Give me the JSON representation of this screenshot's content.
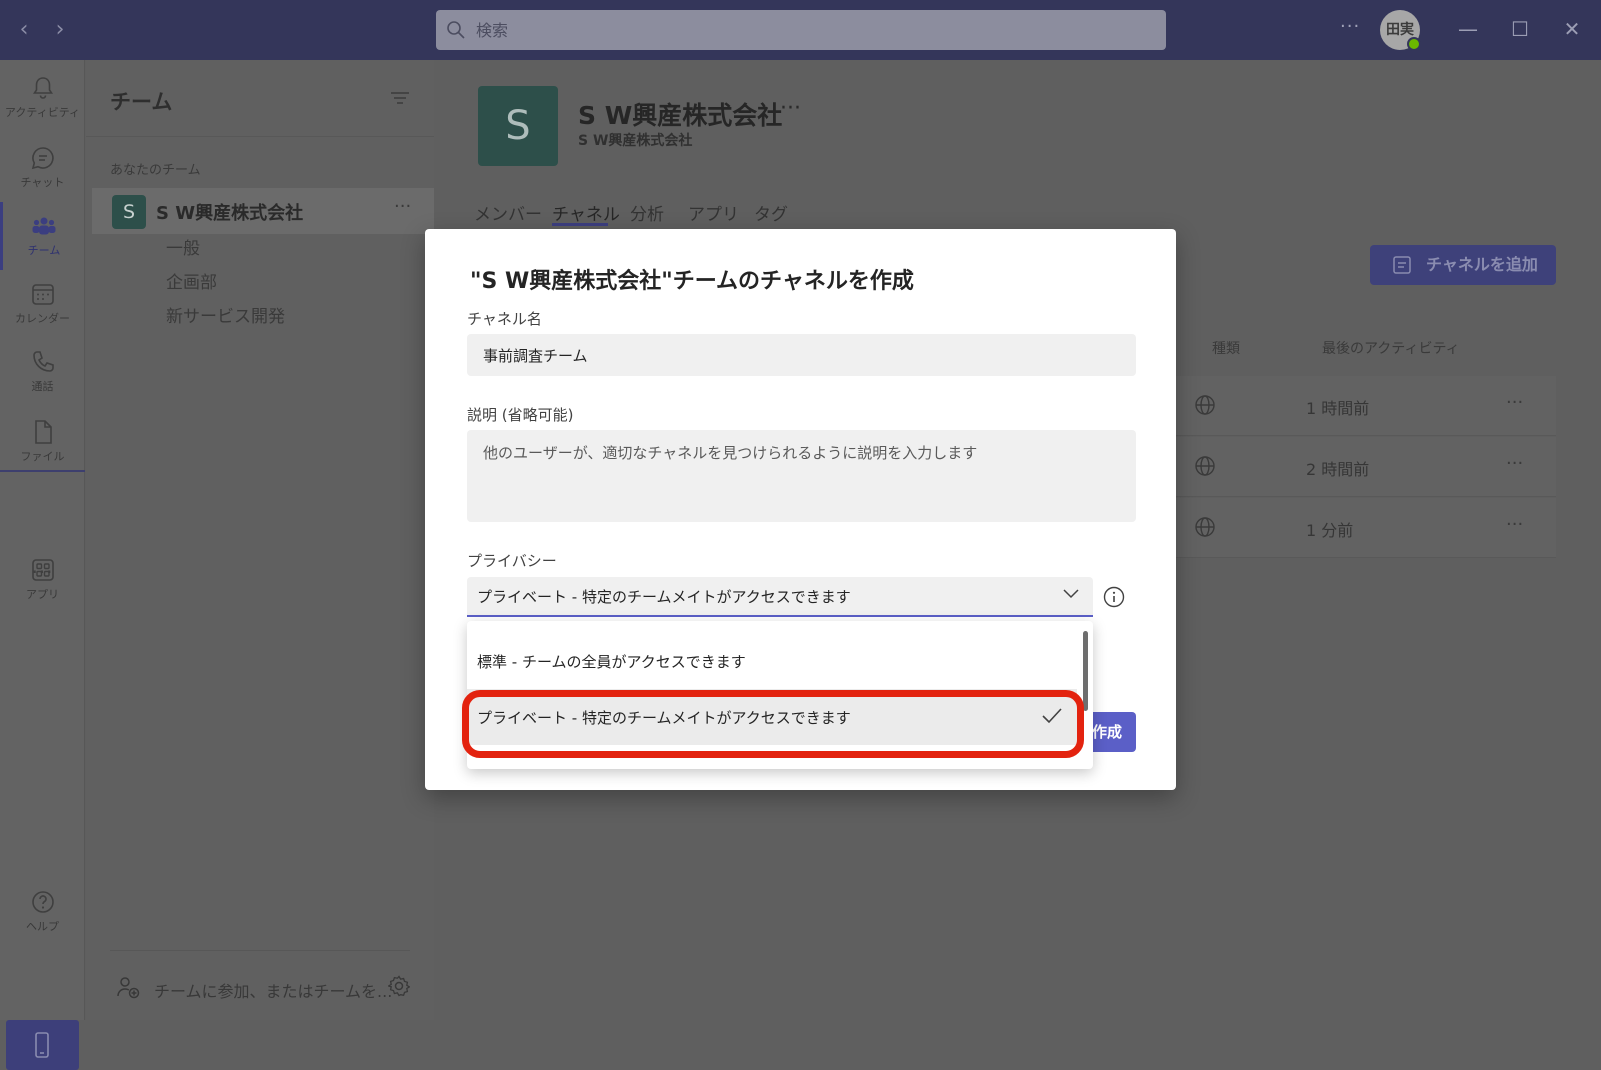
{
  "titlebar": {
    "search_placeholder": "検索",
    "more": "···",
    "avatar_initials": "田実"
  },
  "rail": {
    "items": [
      {
        "label": "アクティビティ",
        "icon": "bell-icon"
      },
      {
        "label": "チャット",
        "icon": "chat-icon"
      },
      {
        "label": "チーム",
        "icon": "teams-icon"
      },
      {
        "label": "カレンダー",
        "icon": "calendar-icon"
      },
      {
        "label": "通話",
        "icon": "phone-icon"
      },
      {
        "label": "ファイル",
        "icon": "file-icon"
      },
      {
        "label": "アプリ",
        "icon": "apps-icon"
      },
      {
        "label": "ヘルプ",
        "icon": "help-icon"
      }
    ],
    "more": "···"
  },
  "panel": {
    "title": "チーム",
    "section_label": "あなたのチーム",
    "team": {
      "badge": "S",
      "name": "S W興産株式会社",
      "more": "···"
    },
    "channels": [
      "一般",
      "企画部",
      "新サービス開発"
    ],
    "join_text": "チームに参加、またはチームを..."
  },
  "main": {
    "logo_letter": "S",
    "title": "S W興産株式会社",
    "title_more": "···",
    "subtitle": "S W興産株式会社",
    "tabs": [
      "メンバー",
      "チャネル",
      "分析",
      "アプリ",
      "タグ"
    ],
    "add_channel_label": "チャネルを追加",
    "columns": {
      "type": "種類",
      "last_activity": "最後のアクティビティ"
    },
    "rows": [
      {
        "time": "1 時間前",
        "more": "···"
      },
      {
        "time": "2 時間前",
        "more": "···"
      },
      {
        "time": "1 分前",
        "more": "···"
      }
    ]
  },
  "modal": {
    "title": "\"S W興産株式会社\"チームのチャネルを作成",
    "channel_name_label": "チャネル名",
    "channel_name_value": "事前調査チーム",
    "description_label": "説明 (省略可能)",
    "description_placeholder": "他のユーザーが、適切なチャネルを見つけられるように説明を入力します",
    "privacy_label": "プライバシー",
    "privacy_selected": "プライベート - 特定のチームメイトがアクセスできます",
    "privacy_options": [
      "標準 - チームの全員がアクセスできます",
      "プライベート - 特定のチームメイトがアクセスできます"
    ],
    "create_label": "作成"
  },
  "colors": {
    "accent": "#5b5fc7",
    "highlight": "#e3230f",
    "team_badge": "#2d4f4a"
  }
}
